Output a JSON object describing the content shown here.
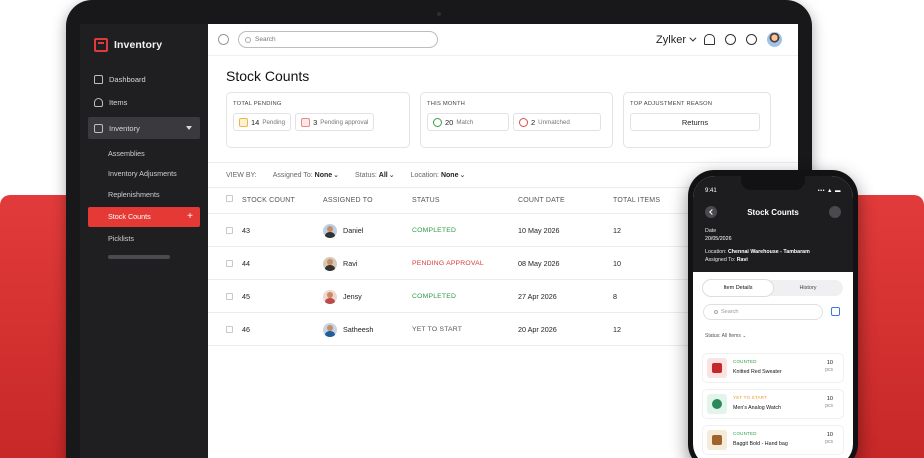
{
  "app": {
    "brand": "Inventory",
    "nav": [
      {
        "label": "Dashboard"
      },
      {
        "label": "Items"
      }
    ],
    "group_label": "Inventory",
    "sub_items": [
      {
        "label": "Assemblies"
      },
      {
        "label": "Inventory Adjusments"
      },
      {
        "label": "Replenishments"
      },
      {
        "label": "Stock Counts",
        "active": true
      },
      {
        "label": "Picklists"
      }
    ],
    "plus": "+"
  },
  "topbar": {
    "search_placeholder": "Search",
    "org": "Zylker"
  },
  "page": {
    "title": "Stock Counts",
    "cards": {
      "pending": {
        "title": "TOTAL PENDING",
        "pending_count": "14",
        "pending_label": "Pending",
        "approval_count": "3",
        "approval_label": "Pending approval"
      },
      "month": {
        "title": "THIS MONTH",
        "match_count": "20",
        "match_label": "Match",
        "unmatched_count": "2",
        "unmatched_label": "Unmatched"
      },
      "reason": {
        "title": "TOP ADJUSTMENT REASON",
        "value": "Returns"
      }
    },
    "filters": {
      "view_by": "VIEW BY:",
      "assigned_label": "Assigned To:",
      "assigned_value": "None",
      "status_label": "Status:",
      "status_value": "All",
      "location_label": "Location:",
      "location_value": "None"
    },
    "table": {
      "headers": [
        "STOCK COUNT",
        "ASSIGNED TO",
        "STATUS",
        "COUNT DATE",
        "TOTAL ITEMS"
      ],
      "rows": [
        {
          "count": "43",
          "assigned": "Daniel",
          "status": "COMPLETED",
          "date": "10 May 2026",
          "total": "12"
        },
        {
          "count": "44",
          "assigned": "Ravi",
          "status": "PENDING APPROVAL",
          "date": "08 May 2026",
          "total": "10"
        },
        {
          "count": "45",
          "assigned": "Jensy",
          "status": "COMPLETED",
          "date": "27 Apr 2026",
          "total": "8"
        },
        {
          "count": "46",
          "assigned": "Satheesh",
          "status": "YET TO START",
          "date": "20 Apr 2026",
          "total": "12"
        }
      ]
    }
  },
  "phone": {
    "time": "9:41",
    "signal": "••• ▲ ▬",
    "title": "Stock Counts",
    "date_label": "Date",
    "date_value": "20/05/2026",
    "location_label": "Location:",
    "location_value": "Chennai Warehouse - Tambaram",
    "assigned_label": "Assigned To:",
    "assigned_value": "Ravi",
    "tab_details": "Item Details",
    "tab_history": "History",
    "search_placeholder": "Search",
    "status_filter": "Status: All Items ⌄",
    "items": [
      {
        "status": "COUNTED",
        "name": "Knitted Red Sweater",
        "qty": "10",
        "unit": "pcs"
      },
      {
        "status": "YET TO START",
        "name": "Men's Analog Watch",
        "qty": "10",
        "unit": "pcs"
      },
      {
        "status": "COUNTED",
        "name": "Baggit Bold - Hand bag",
        "qty": "10",
        "unit": "pcs"
      }
    ]
  },
  "colors": {
    "accent": "#e53935",
    "completed": "#2e9b46",
    "pending": "#d83b3b",
    "yet": "#555555",
    "phone_yet": "#e89a2c"
  }
}
